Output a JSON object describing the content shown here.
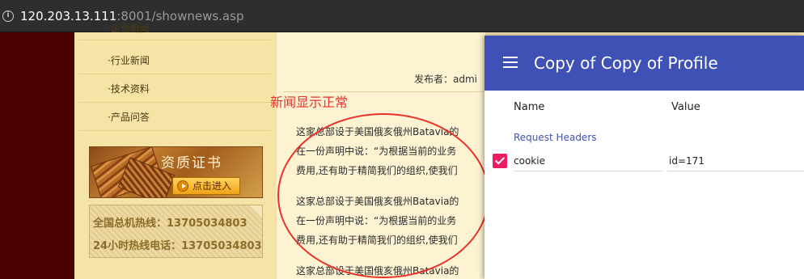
{
  "browser": {
    "url_host": "120.203.13.111",
    "url_rest": ":8001/shownews.asp"
  },
  "sidebar": {
    "items": [
      {
        "label": "·企业新闻"
      },
      {
        "label": "·行业新闻"
      },
      {
        "label": "·技术资料"
      },
      {
        "label": "·产品问答"
      }
    ],
    "cert_banner": {
      "title": "资质证书",
      "button": "点击进入"
    },
    "hotline": {
      "line1": "全国总机热线：13705034803",
      "line2": "24小时热线电话：13705034803"
    }
  },
  "article": {
    "publisher": "发布者：admi",
    "paragraphs": [
      [
        "这家总部设于美国俄亥俄州Batavia的",
        "在一份声明中说：“为根据当前的业务",
        "费用,还有助于精简我们的组织,使我们"
      ],
      [
        "这家总部设于美国俄亥俄州Batavia的",
        "在一份声明中说：“为根据当前的业务",
        "费用,还有助于精简我们的组织,使我们"
      ],
      [
        "这家总部设于美国俄亥俄州Batavia的"
      ]
    ]
  },
  "annotation": {
    "text": "新闻显示正常",
    "color": "#e8322a"
  },
  "devtools": {
    "title": "Copy of Copy of Profile",
    "header_color": "#3f51b5",
    "columns": {
      "name": "Name",
      "value": "Value"
    },
    "section": "Request Headers",
    "headers": [
      {
        "name": "cookie",
        "value": "id=171",
        "checked": true
      }
    ]
  }
}
